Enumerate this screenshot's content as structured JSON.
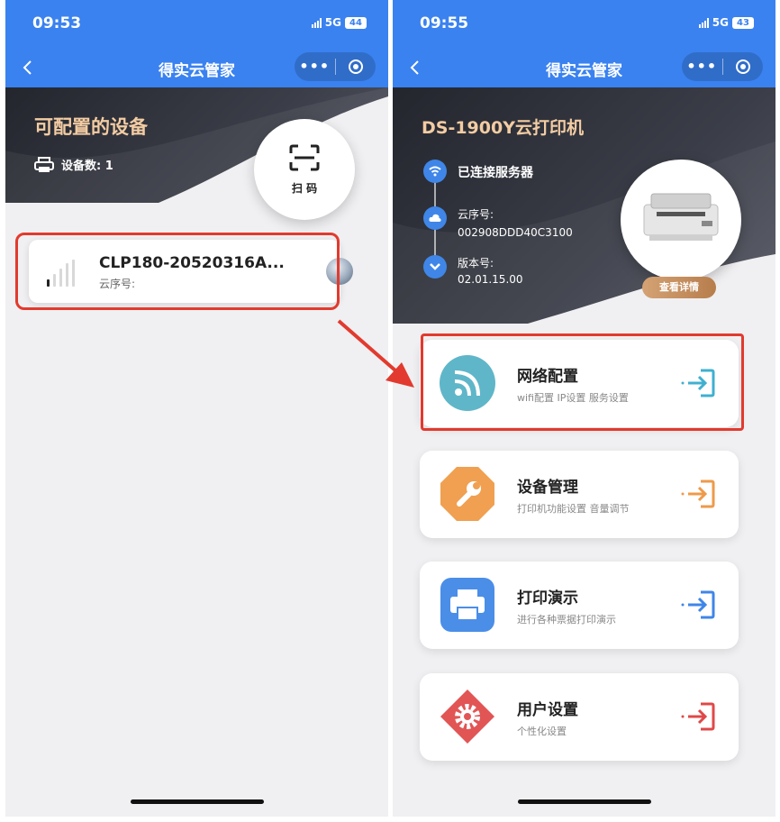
{
  "left_screen": {
    "status": {
      "time": "09:53",
      "network": "5G",
      "battery": "44"
    },
    "navbar": {
      "title": "得实云管家"
    },
    "hero": {
      "title": "可配置的设备",
      "device_count_label": "设备数: 1"
    },
    "scan_button": {
      "label": "扫 码"
    },
    "device": {
      "name": "CLP180-20520316A...",
      "cloud_serial_label": "云序号:"
    }
  },
  "right_screen": {
    "status": {
      "time": "09:55",
      "network": "5G",
      "battery": "43"
    },
    "navbar": {
      "title": "得实云管家"
    },
    "printer": {
      "title": "DS-1900Y云打印机",
      "connection_status": "已连接服务器",
      "serial_label": "云序号:",
      "serial_value": "002908DDD40C3100",
      "version_label": "版本号:",
      "version_value": "02.01.15.00",
      "details_button": "查看详情"
    },
    "menu": [
      {
        "title": "网络配置",
        "subtitle": "wifi配置 IP设置 服务设置",
        "icon": "wifi-icon",
        "color": "#5fb6c9"
      },
      {
        "title": "设备管理",
        "subtitle": "打印机功能设置 音量调节",
        "icon": "wrench-icon",
        "color": "#f0a050"
      },
      {
        "title": "打印演示",
        "subtitle": "进行各种票据打印演示",
        "icon": "printer-icon",
        "color": "#4a8ee8"
      },
      {
        "title": "用户设置",
        "subtitle": "个性化设置",
        "icon": "gear-icon",
        "color": "#e25555"
      }
    ]
  },
  "colors": {
    "nav_blue": "#3a82f0",
    "gold_text": "#f3cca3",
    "highlight_red": "#e23a2e"
  }
}
